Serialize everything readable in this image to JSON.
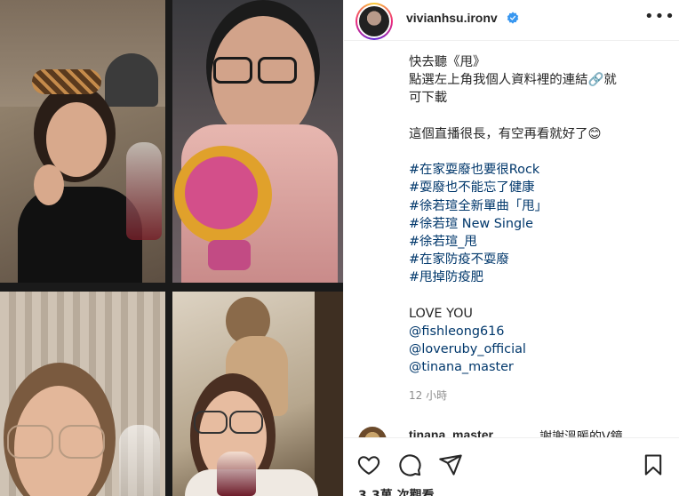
{
  "post": {
    "username": "vivianhsu.ironv",
    "more_label": "•••",
    "caption_lines": [
      "快去聽《甩》",
      "點選左上角我個人資料裡的連結🔗就",
      "可下載",
      "",
      "這個直播很長，有空再看就好了😊",
      "",
      "#在家耍廢也要很Rock",
      "#耍廢也不能忘了健康",
      "#徐若瑄全新單曲「甩」",
      "#徐若瑄 New Single",
      "#徐若瑄_甩",
      "#在家防疫不耍廢",
      "#甩掉防疫肥",
      "",
      "LOVE YOU",
      "@fishleong616",
      "@loveruby_official",
      "@tinana_master"
    ],
    "timestamp": "12 小時",
    "comment_preview": {
      "username": "tinana_master",
      "text": "謝謝溫暖的V鏡"
    },
    "likes_text": "3.3萬 次觀看"
  },
  "icons": {
    "verified": "verified-badge-icon",
    "like": "heart-icon",
    "comment": "comment-icon",
    "share": "share-icon",
    "save": "bookmark-icon",
    "more": "more-options-icon"
  },
  "colors": {
    "text": "#262626",
    "link": "#00376b",
    "muted": "#8e8e8e",
    "verified": "#3897f0",
    "divider": "#efefef"
  }
}
